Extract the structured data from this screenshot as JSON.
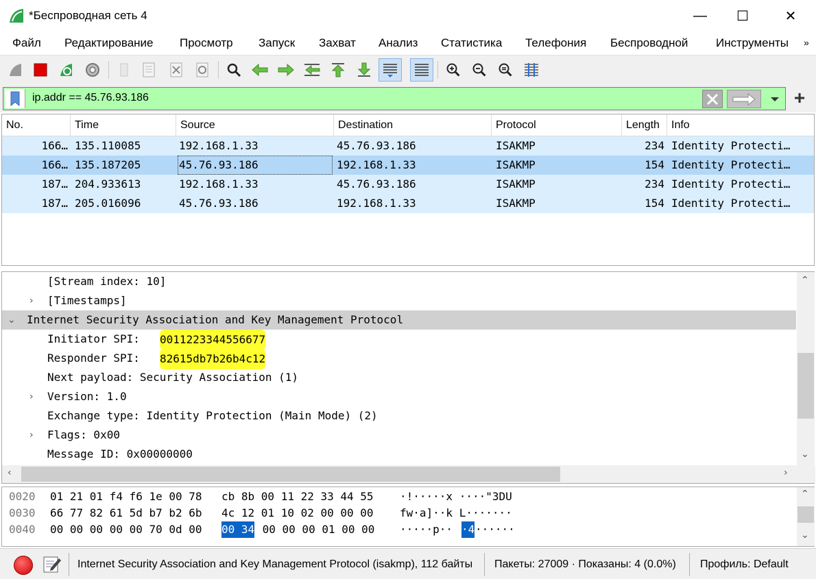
{
  "window": {
    "title": "*Беспроводная сеть 4",
    "min_glyph": "—",
    "max_glyph": "☐",
    "close_glyph": "✕"
  },
  "menu": {
    "items": [
      "Файл",
      "Редактирование",
      "Просмотр",
      "Запуск",
      "Захват",
      "Анализ",
      "Статистика",
      "Телефония",
      "Беспроводной",
      "Инструменты"
    ],
    "more_glyph": "»"
  },
  "toolbar": {
    "icons": [
      "shark-fin-start-icon",
      "stop-capture-icon",
      "restart-capture-icon",
      "capture-options-icon",
      "open-file-icon",
      "save-file-icon",
      "close-file-icon",
      "reload-file-icon",
      "find-packet-icon",
      "go-back-icon",
      "go-forward-icon",
      "go-to-packet-icon",
      "go-first-icon",
      "go-last-icon",
      "autoscroll-icon",
      "colorize-icon",
      "zoom-in-icon",
      "zoom-out-icon",
      "normal-size-icon",
      "resize-columns-icon"
    ]
  },
  "filter": {
    "value": "ip.addr == 45.76.93.186",
    "add_glyph": "+"
  },
  "packet_list": {
    "columns": [
      "No.",
      "Time",
      "Source",
      "Destination",
      "Protocol",
      "Length",
      "Info"
    ],
    "rows": [
      {
        "no": "166…",
        "time": "135.110085",
        "source": "192.168.1.33",
        "destination": "45.76.93.186",
        "protocol": "ISAKMP",
        "length": "234",
        "info": "Identity Protecti…"
      },
      {
        "no": "166…",
        "time": "135.187205",
        "source": "45.76.93.186",
        "destination": "192.168.1.33",
        "protocol": "ISAKMP",
        "length": "154",
        "info": "Identity Protecti…"
      },
      {
        "no": "187…",
        "time": "204.933613",
        "source": "192.168.1.33",
        "destination": "45.76.93.186",
        "protocol": "ISAKMP",
        "length": "234",
        "info": "Identity Protecti…"
      },
      {
        "no": "187…",
        "time": "205.016096",
        "source": "45.76.93.186",
        "destination": "192.168.1.33",
        "protocol": "ISAKMP",
        "length": "154",
        "info": "Identity Protecti…"
      }
    ],
    "selected_row": 1
  },
  "details": {
    "lines": [
      {
        "text": "[Stream index: 10]",
        "arrow": ""
      },
      {
        "text": "[Timestamps]",
        "arrow": "›"
      },
      {
        "text": "Internet Security Association and Key Management Protocol",
        "arrow": "⌄"
      },
      {
        "text": "Initiator SPI: ",
        "value": "0011223344556677",
        "arrow": ""
      },
      {
        "text": "Responder SPI: ",
        "value": "82615db7b26b4c12",
        "arrow": ""
      },
      {
        "text": "Next payload: Security Association (1)",
        "arrow": ""
      },
      {
        "text": "Version: 1.0",
        "arrow": "›"
      },
      {
        "text": "Exchange type: Identity Protection (Main Mode) (2)",
        "arrow": ""
      },
      {
        "text": "Flags: 0x00",
        "arrow": "›"
      },
      {
        "text": "Message ID: 0x00000000",
        "arrow": ""
      }
    ]
  },
  "bytes": {
    "lines": [
      {
        "offset": "0020",
        "hex_a": "01 21 01 f4 f6 1e 00 78",
        "hex_b": "cb 8b 00 11 22 33 44 55",
        "ascii": "·!·····x ····\"3DU"
      },
      {
        "offset": "0030",
        "hex_a": "66 77 82 61 5d b7 b2 6b",
        "hex_b": "4c 12 01 10 02 00 00 00",
        "ascii": "fw·a]··k L·······"
      },
      {
        "offset": "0040",
        "hex_a": "00 00 00 00 00 70 0d 00",
        "hex_b_sel": "00 34",
        "hex_b_rest": " 00 00 00 01 00 00",
        "ascii_a": "·····p·· ",
        "ascii_sel": "·4",
        "ascii_b": "······"
      }
    ]
  },
  "status": {
    "field_info": "Internet Security Association and Key Management Protocol (isakmp), 112 байты",
    "packets": "Пакеты: 27009 · Показаны: 4 (0.0%)",
    "profile": "Профиль: Default"
  },
  "colors": {
    "filter_bg": "#afffaf",
    "row_bg": "#daeefe",
    "selected_row_bg": "#b3d7f7",
    "highlight_yellow": "#ffff30",
    "byte_selection": "#0a64c8"
  }
}
